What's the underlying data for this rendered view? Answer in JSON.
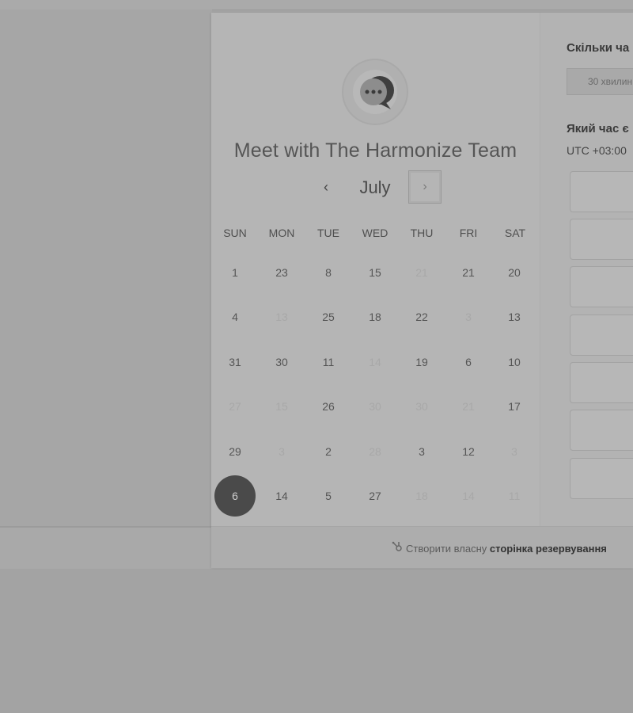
{
  "widget": {
    "title": "Meet with The Harmonize Team",
    "month": "July",
    "prev_glyph": "‹",
    "next_glyph": "›"
  },
  "weekdays": [
    "SUN",
    "MON",
    "TUE",
    "WED",
    "THU",
    "FRI",
    "SAT"
  ],
  "calendar": {
    "weeks": [
      [
        {
          "t": "1"
        },
        {
          "t": "23"
        },
        {
          "t": "8"
        },
        {
          "t": "15"
        },
        {
          "t": "21",
          "dim": true
        },
        {
          "t": "21"
        },
        {
          "t": "20"
        }
      ],
      [
        {
          "t": "4"
        },
        {
          "t": "13",
          "dim": true
        },
        {
          "t": "25"
        },
        {
          "t": "18"
        },
        {
          "t": "22"
        },
        {
          "t": "3",
          "dim": true
        },
        {
          "t": "13"
        }
      ],
      [
        {
          "t": "31"
        },
        {
          "t": "30"
        },
        {
          "t": "11"
        },
        {
          "t": "14",
          "dim": true
        },
        {
          "t": "19"
        },
        {
          "t": "6"
        },
        {
          "t": "10"
        }
      ],
      [
        {
          "t": "27",
          "dim": true
        },
        {
          "t": "15",
          "dim": true
        },
        {
          "t": "26"
        },
        {
          "t": "30",
          "dim": true
        },
        {
          "t": "30",
          "dim": true
        },
        {
          "t": "21",
          "dim": true
        },
        {
          "t": "17"
        }
      ],
      [
        {
          "t": "29"
        },
        {
          "t": "3",
          "dim": true
        },
        {
          "t": "2"
        },
        {
          "t": "28",
          "dim": true
        },
        {
          "t": "3"
        },
        {
          "t": "12"
        },
        {
          "t": "3",
          "dim": true
        }
      ],
      [
        {
          "t": "6",
          "selected": true
        },
        {
          "t": "14"
        },
        {
          "t": "5"
        },
        {
          "t": "27"
        },
        {
          "t": "18",
          "dim": true
        },
        {
          "t": "14",
          "dim": true
        },
        {
          "t": "11",
          "dim": true
        }
      ]
    ]
  },
  "right_panel": {
    "duration_question": "Скільки ча",
    "duration_value": "30 хвилин",
    "time_question": "Який час є",
    "timezone": "UTC +03:00"
  },
  "footer": {
    "text_prefix": "Створити власну",
    "text_bold": "сторінка резервування"
  },
  "colors": {
    "selected_day": "#4a4a4a",
    "page_background": "#a3a3a3"
  },
  "icons": {
    "avatar": "chat-bubble-icon",
    "footer": "sprocket-icon"
  }
}
